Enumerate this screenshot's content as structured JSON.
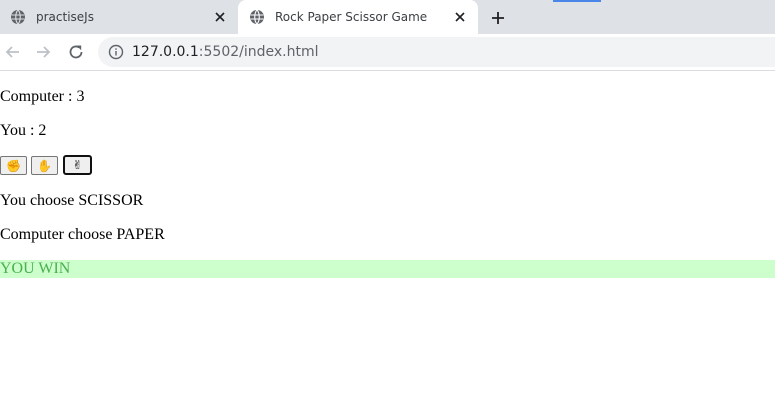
{
  "browser": {
    "tabs": [
      {
        "title": "practiseJs",
        "active": false,
        "icon": "globe-icon"
      },
      {
        "title": "Rock Paper Scissor Game",
        "active": true,
        "icon": "globe-icon"
      }
    ],
    "address": {
      "host": "127.0.0.1",
      "rest": ":5502/index.html"
    },
    "icons": {
      "back": "arrow-left-icon",
      "forward": "arrow-right-icon",
      "reload": "reload-icon",
      "info": "info-icon",
      "close": "close-icon",
      "new_tab": "plus-icon"
    }
  },
  "game": {
    "computer_score": "Computer : 3",
    "you_score": "You : 2",
    "buttons": [
      {
        "name": "rock",
        "icon": "fist-icon",
        "glyph": "✊"
      },
      {
        "name": "paper",
        "icon": "palm-icon",
        "glyph": "✋"
      },
      {
        "name": "scissor",
        "icon": "scissor-hand-icon",
        "glyph": "✌",
        "selected": true
      }
    ],
    "you_choice": "You choose SCISSOR",
    "computer_choice": "Computer choose PAPER",
    "result": "YOU WIN"
  },
  "colors": {
    "result_bg": "#ccffcc",
    "result_text": "#4caf50",
    "tabstrip_bg": "#dee1e6",
    "omnibox_bg": "#f1f3f4"
  }
}
